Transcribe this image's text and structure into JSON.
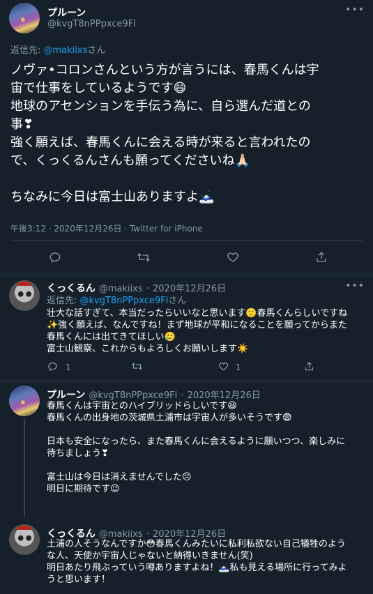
{
  "main_tweet": {
    "name": "プルーン",
    "handle": "@kvgT8nPPpxce9Fl",
    "reply_prefix": "返信先: ",
    "reply_to": "@makiixs",
    "reply_suffix": "さん",
    "lines": [
      "ノヴァ•コロンさんという方が言うには、春馬くんは宇",
      "宙で仕事をしているようです😄",
      "地球のアセンションを手伝う為に、自ら選んだ道との",
      "事❣",
      "強く願えば、春馬くんに会える時が来ると言われたの",
      "で、くっくるんさんも願ってくださいね🙏🏻",
      "",
      "ちなみに今日は富士山ありますよ🗻"
    ],
    "meta": "午後3:12 · 2020年12月26日 · Twitter for iPhone"
  },
  "replies": [
    {
      "name": "くっくるん",
      "handle": "@makiixs",
      "date": "2020年12月26日",
      "reply_prefix": "返信先: ",
      "reply_to": "@kvgT8nPPpxce9Fl",
      "reply_suffix": "さん",
      "lines": [
        "壮大な話すぎて、本当だったらいいなと思います🙂春馬くんらしいですね",
        "✨強く願えば、なんですね！まず地球が平和になることを願ってからまた",
        "春馬くんには出てきてほしい🥲",
        "富士山観察、これからもよろしくお願いします☀️"
      ],
      "reply_count": "1",
      "like_count": "1"
    },
    {
      "name": "プルーン",
      "handle": "@kvgT8nPPpxce9Fl",
      "date": "2020年12月26日",
      "lines": [
        "春馬くんは宇宙とのハイブリッドらしいです😆",
        "春馬くんの出身地の茨城県土浦市は宇宙人が多いそうです😨",
        "",
        "日本も安全になったら、また春馬くんに会えるように願いつつ、楽しみに",
        "待ちましょう❣",
        "",
        "富士山は今日は消えませんでした😣",
        "明日に期待です😉"
      ]
    },
    {
      "name": "くっくるん",
      "handle": "@makiixs",
      "date": "2020年12月26日",
      "lines": [
        "土浦の人そうなんですか😳春馬くんみたいに私利私欲ない自己犠牲のよう",
        "な人、天使か宇宙人じゃないと納得いきません(笑)",
        "明日あたり飛ぶっていう噂ありますよね！🗻私も見える場所に行ってみよ",
        "うと思います！"
      ]
    }
  ],
  "icons": {
    "more": "more-dots-icon",
    "reply": "reply-icon",
    "retweet": "retweet-icon",
    "like": "heart-icon",
    "share": "share-icon"
  },
  "colors": {
    "background": "#15202b",
    "link": "#1da1f2",
    "muted": "#8899a6",
    "separator": "#38444d"
  }
}
